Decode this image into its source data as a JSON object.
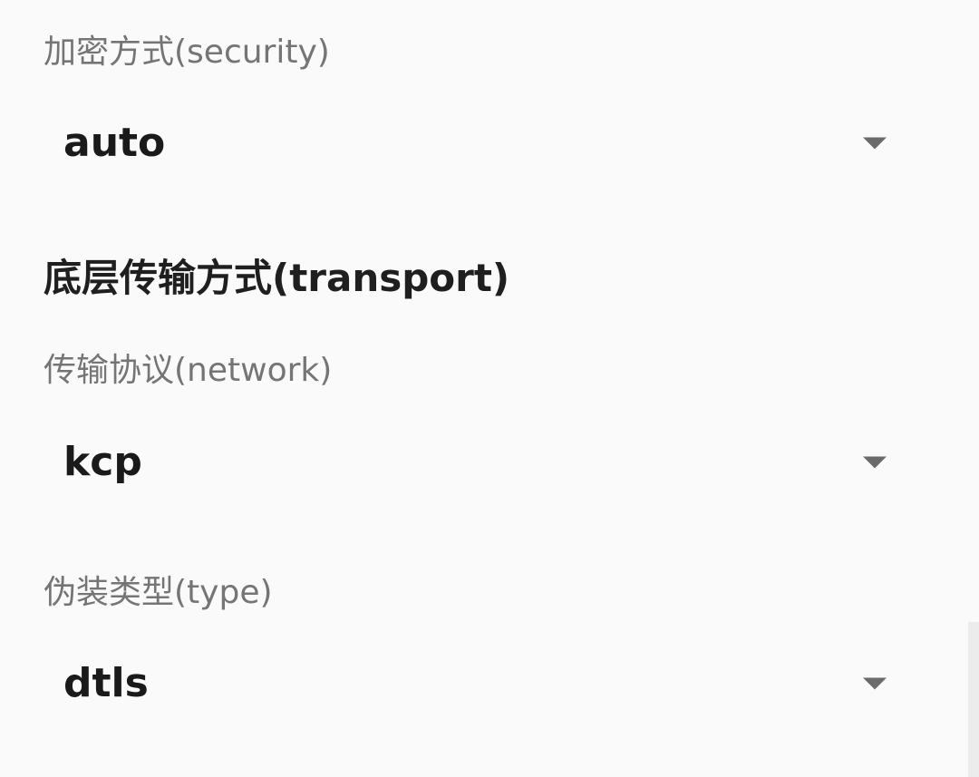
{
  "security": {
    "label": "加密方式(security)",
    "value": "auto"
  },
  "transport_section": {
    "title": "底层传输方式(transport)"
  },
  "network": {
    "label": "传输协议(network)",
    "value": "kcp"
  },
  "header_type": {
    "label": "伪装类型(type)",
    "value": "dtls"
  },
  "icons": {
    "dropdown": "dropdown-arrow-icon"
  },
  "colors": {
    "background": "#fafafa",
    "label": "#757575",
    "title": "#1f1f1f",
    "value": "#1a1a1a",
    "arrow": "#6b6b6b"
  }
}
